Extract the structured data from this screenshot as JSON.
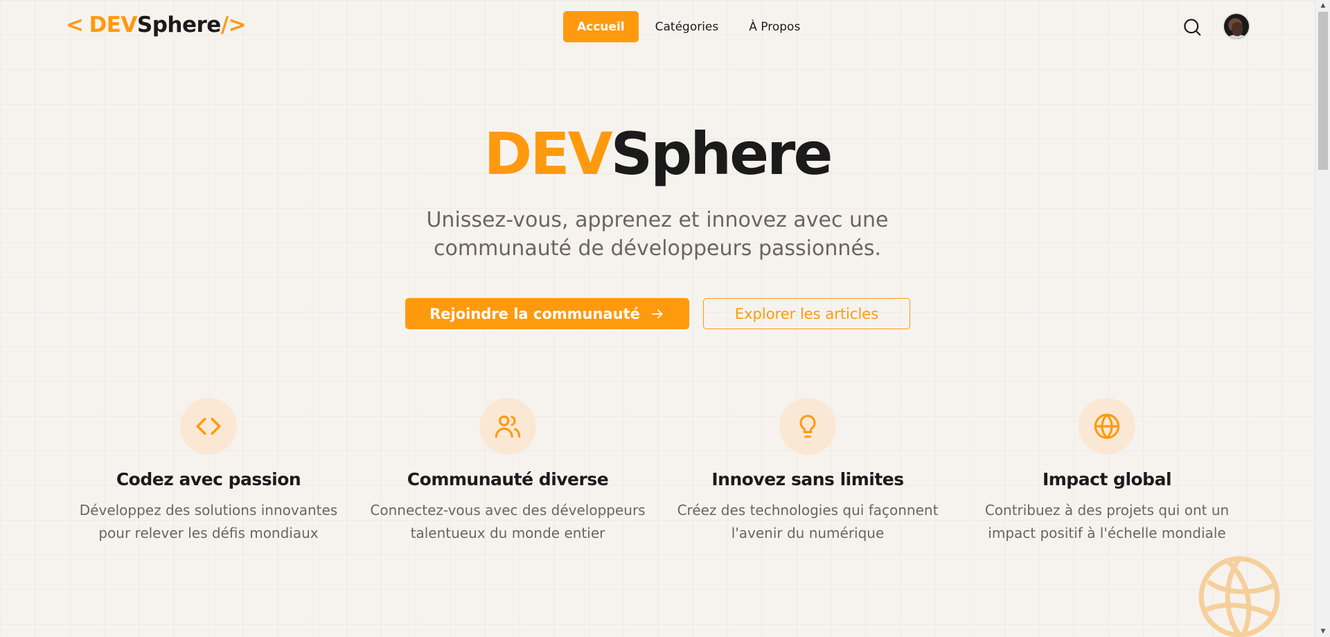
{
  "header": {
    "logo": {
      "open_bracket": "<",
      "dev": "DEV",
      "sphere": "Sphere",
      "slash": "/",
      "close_bracket": ">"
    },
    "nav": [
      {
        "label": "Accueil",
        "active": true
      },
      {
        "label": "Catégories",
        "active": false
      },
      {
        "label": "À Propos",
        "active": false
      }
    ],
    "search_icon": "search-icon",
    "avatar_icon": "user-avatar"
  },
  "hero": {
    "title_dev": "DEV",
    "title_sphere": "Sphere",
    "subtitle": "Unissez-vous, apprenez et innovez avec une communauté de développeurs passionnés.",
    "primary_button": "Rejoindre la communauté",
    "primary_button_icon": "arrow-right-icon",
    "secondary_button": "Explorer les articles"
  },
  "features": [
    {
      "icon": "code-icon",
      "title": "Codez avec passion",
      "description": "Développez des solutions innovantes pour relever les défis mondiaux"
    },
    {
      "icon": "users-icon",
      "title": "Communauté diverse",
      "description": "Connectez-vous avec des développeurs talentueux du monde entier"
    },
    {
      "icon": "lightbulb-icon",
      "title": "Innovez sans limites",
      "description": "Créez des technologies qui façonnent l'avenir du numérique"
    },
    {
      "icon": "globe-icon",
      "title": "Impact global",
      "description": "Contribuez à des projets qui ont un impact positif à l'échelle mondiale"
    }
  ],
  "colors": {
    "accent": "#ff9a0e",
    "accent_soft": "#fbe8d4",
    "background": "#f6f3ef",
    "text": "#1b1b1b",
    "muted": "#6b6560"
  }
}
